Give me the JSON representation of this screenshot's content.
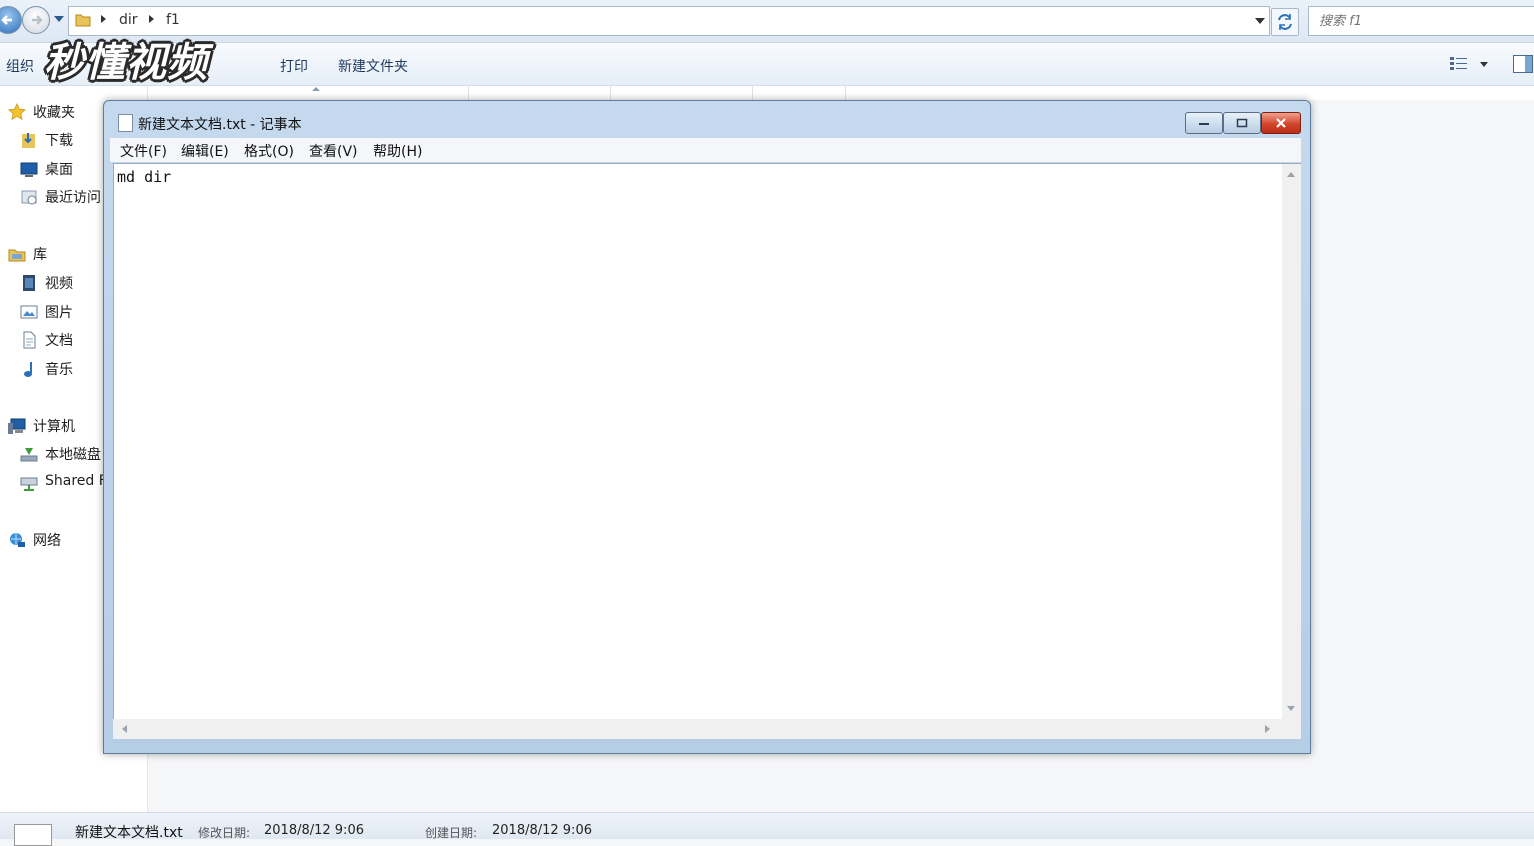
{
  "explorer": {
    "address": {
      "crumbs": [
        "dir",
        "f1"
      ],
      "search_placeholder": "搜索 f1"
    },
    "toolbar": {
      "organize": "组织",
      "print": "打印",
      "new_folder": "新建文件夹"
    },
    "nav": {
      "favorites": "收藏夹",
      "downloads": "下载",
      "desktop": "桌面",
      "recent": "最近访问",
      "libraries": "库",
      "videos": "视频",
      "pictures": "图片",
      "documents": "文档",
      "music": "音乐",
      "computer": "计算机",
      "local_disk": "本地磁盘",
      "shared": "Shared F",
      "network": "网络"
    },
    "status": {
      "file_name": "新建文本文档.txt",
      "modified_label": "修改日期:",
      "modified_value": "2018/8/12 9:06",
      "created_label": "创建日期:",
      "created_value": "2018/8/12 9:06"
    }
  },
  "watermark": "秒懂视频",
  "notepad": {
    "title": "新建文本文档.txt - 记事本",
    "menu": [
      "文件(F)",
      "编辑(E)",
      "格式(O)",
      "查看(V)",
      "帮助(H)"
    ],
    "content": "md dir"
  },
  "colors": {
    "accent": "#2a6fb8",
    "close_button": "#d2452b",
    "title_bar": "#c5d9ee"
  }
}
